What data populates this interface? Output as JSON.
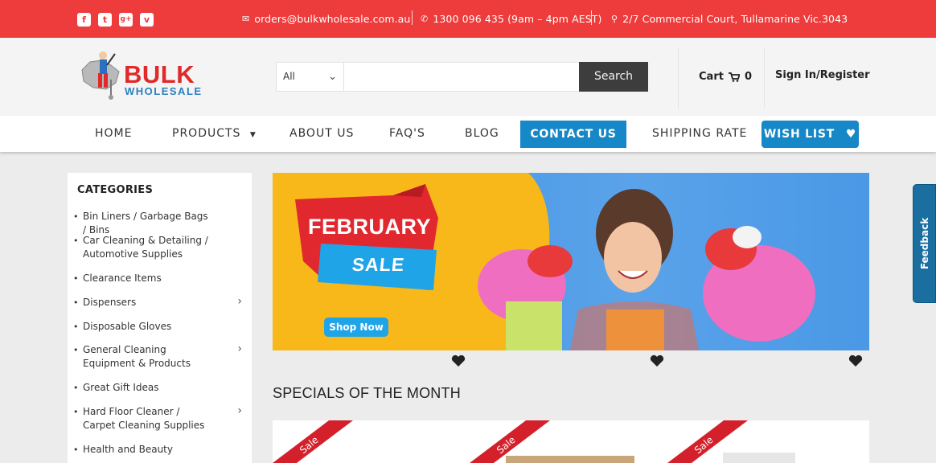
{
  "topbar": {
    "social_icons": [
      "facebook-icon",
      "twitter-icon",
      "google-plus-icon",
      "vimeo-icon"
    ],
    "email": "orders@bulkwholesale.com.au",
    "phone": "1300 096 435 (9am – 4pm AEST)",
    "address": "2/7 Commercial Court, Tullamarine Vic.3043"
  },
  "logo": {
    "line1": "BULK",
    "line2": "WHOLESALE"
  },
  "search": {
    "category": "All",
    "placeholder": "",
    "button": "Search"
  },
  "cart": {
    "label": "Cart",
    "count": "0"
  },
  "account": {
    "label": "Sign In/Register"
  },
  "nav": {
    "home": "HOME",
    "products": "PRODUCTS",
    "about": "ABOUT US",
    "faq": "FAQ'S",
    "blog": "BLOG",
    "contact": "CONTACT US",
    "shipping": "SHIPPING RATE",
    "wishlist": "WISH LIST"
  },
  "sidebar": {
    "title": "CATEGORIES",
    "items": [
      {
        "label": "Bin Liners / Garbage Bags / Bins",
        "has_sub": false
      },
      {
        "label": "Car Cleaning & Detailing / Automotive Supplies",
        "has_sub": false
      },
      {
        "label": "Clearance Items",
        "has_sub": false
      },
      {
        "label": "Dispensers",
        "has_sub": true
      },
      {
        "label": "Disposable Gloves",
        "has_sub": false
      },
      {
        "label": "General Cleaning Equipment & Products",
        "has_sub": true
      },
      {
        "label": "Great Gift Ideas",
        "has_sub": false
      },
      {
        "label": "Hard Floor Cleaner / Carpet Cleaning Supplies",
        "has_sub": true
      },
      {
        "label": "Health and Beauty",
        "has_sub": false
      }
    ]
  },
  "banner": {
    "title": "FEBRUARY",
    "subtitle": "SALE",
    "cta": "Shop Now"
  },
  "specials": {
    "title": "SPECIALS OF THE MONTH",
    "badge": "Sale"
  },
  "feedback": "Feedback",
  "colors": {
    "brand_red": "#ee3b3b",
    "accent_blue": "#1788c7",
    "dark_button": "#3d3d3d"
  }
}
